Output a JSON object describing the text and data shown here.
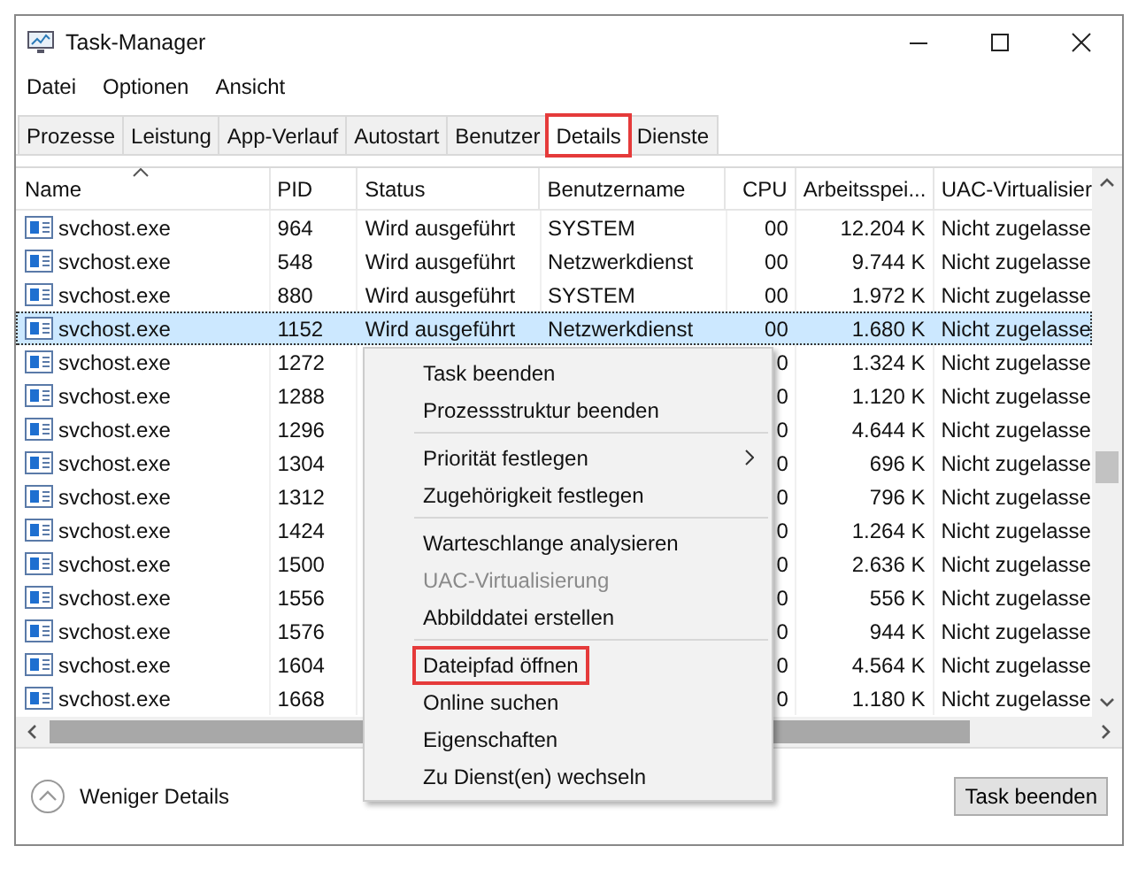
{
  "window": {
    "title": "Task-Manager"
  },
  "menu_bar": [
    "Datei",
    "Optionen",
    "Ansicht"
  ],
  "tabs": [
    {
      "label": "Prozesse",
      "selected": false,
      "highlighted": false
    },
    {
      "label": "Leistung",
      "selected": false,
      "highlighted": false
    },
    {
      "label": "App-Verlauf",
      "selected": false,
      "highlighted": false
    },
    {
      "label": "Autostart",
      "selected": false,
      "highlighted": false
    },
    {
      "label": "Benutzer",
      "selected": false,
      "highlighted": false
    },
    {
      "label": "Details",
      "selected": true,
      "highlighted": true
    },
    {
      "label": "Dienste",
      "selected": false,
      "highlighted": false
    }
  ],
  "table": {
    "columns": [
      "Name",
      "PID",
      "Status",
      "Benutzername",
      "CPU",
      "Arbeitsspei...",
      "UAC-Virtualisier"
    ],
    "rows": [
      {
        "name": "svchost.exe",
        "pid": "964",
        "status": "Wird ausgeführt",
        "user": "SYSTEM",
        "cpu": "00",
        "memory": "12.204 K",
        "uac": "Nicht zugelasse",
        "selected": false
      },
      {
        "name": "svchost.exe",
        "pid": "548",
        "status": "Wird ausgeführt",
        "user": "Netzwerkdienst",
        "cpu": "00",
        "memory": "9.744 K",
        "uac": "Nicht zugelasse",
        "selected": false
      },
      {
        "name": "svchost.exe",
        "pid": "880",
        "status": "Wird ausgeführt",
        "user": "SYSTEM",
        "cpu": "00",
        "memory": "1.972 K",
        "uac": "Nicht zugelasse",
        "selected": false
      },
      {
        "name": "svchost.exe",
        "pid": "1152",
        "status": "Wird ausgeführt",
        "user": "Netzwerkdienst",
        "cpu": "00",
        "memory": "1.680 K",
        "uac": "Nicht zugelasse",
        "selected": true
      },
      {
        "name": "svchost.exe",
        "pid": "1272",
        "cpu": "0",
        "memory": "1.324 K",
        "uac": "Nicht zugelasse",
        "selected": false
      },
      {
        "name": "svchost.exe",
        "pid": "1288",
        "cpu": "0",
        "memory": "1.120 K",
        "uac": "Nicht zugelasse",
        "selected": false
      },
      {
        "name": "svchost.exe",
        "pid": "1296",
        "cpu": "0",
        "memory": "4.644 K",
        "uac": "Nicht zugelasse",
        "selected": false
      },
      {
        "name": "svchost.exe",
        "pid": "1304",
        "cpu": "0",
        "memory": "696 K",
        "uac": "Nicht zugelasse",
        "selected": false
      },
      {
        "name": "svchost.exe",
        "pid": "1312",
        "cpu": "0",
        "memory": "796 K",
        "uac": "Nicht zugelasse",
        "selected": false
      },
      {
        "name": "svchost.exe",
        "pid": "1424",
        "cpu": "0",
        "memory": "1.264 K",
        "uac": "Nicht zugelasse",
        "selected": false
      },
      {
        "name": "svchost.exe",
        "pid": "1500",
        "cpu": "0",
        "memory": "2.636 K",
        "uac": "Nicht zugelasse",
        "selected": false
      },
      {
        "name": "svchost.exe",
        "pid": "1556",
        "cpu": "0",
        "memory": "556 K",
        "uac": "Nicht zugelasse",
        "selected": false
      },
      {
        "name": "svchost.exe",
        "pid": "1576",
        "cpu": "0",
        "memory": "944 K",
        "uac": "Nicht zugelasse",
        "selected": false
      },
      {
        "name": "svchost.exe",
        "pid": "1604",
        "cpu": "0",
        "memory": "4.564 K",
        "uac": "Nicht zugelasse",
        "selected": false
      },
      {
        "name": "svchost.exe",
        "pid": "1668",
        "cpu": "0",
        "memory": "1.180 K",
        "uac": "Nicht zugelasse",
        "selected": false
      }
    ]
  },
  "context_menu": [
    {
      "kind": "item",
      "label": "Task beenden",
      "disabled": false,
      "highlighted": false,
      "submenu": false
    },
    {
      "kind": "item",
      "label": "Prozessstruktur beenden",
      "disabled": false,
      "highlighted": false,
      "submenu": false
    },
    {
      "kind": "separator"
    },
    {
      "kind": "item",
      "label": "Priorität festlegen",
      "disabled": false,
      "highlighted": false,
      "submenu": true
    },
    {
      "kind": "item",
      "label": "Zugehörigkeit festlegen",
      "disabled": false,
      "highlighted": false,
      "submenu": false
    },
    {
      "kind": "separator"
    },
    {
      "kind": "item",
      "label": "Warteschlange analysieren",
      "disabled": false,
      "highlighted": false,
      "submenu": false
    },
    {
      "kind": "item",
      "label": "UAC-Virtualisierung",
      "disabled": true,
      "highlighted": false,
      "submenu": false
    },
    {
      "kind": "item",
      "label": "Abbilddatei erstellen",
      "disabled": false,
      "highlighted": false,
      "submenu": false
    },
    {
      "kind": "separator"
    },
    {
      "kind": "item",
      "label": "Dateipfad öffnen",
      "disabled": false,
      "highlighted": true,
      "submenu": false
    },
    {
      "kind": "item",
      "label": "Online suchen",
      "disabled": false,
      "highlighted": false,
      "submenu": false
    },
    {
      "kind": "item",
      "label": "Eigenschaften",
      "disabled": false,
      "highlighted": false,
      "submenu": false
    },
    {
      "kind": "item",
      "label": "Zu Dienst(en) wechseln",
      "disabled": false,
      "highlighted": false,
      "submenu": false
    }
  ],
  "footer": {
    "toggle": "Weniger Details",
    "button": "Task beenden"
  }
}
